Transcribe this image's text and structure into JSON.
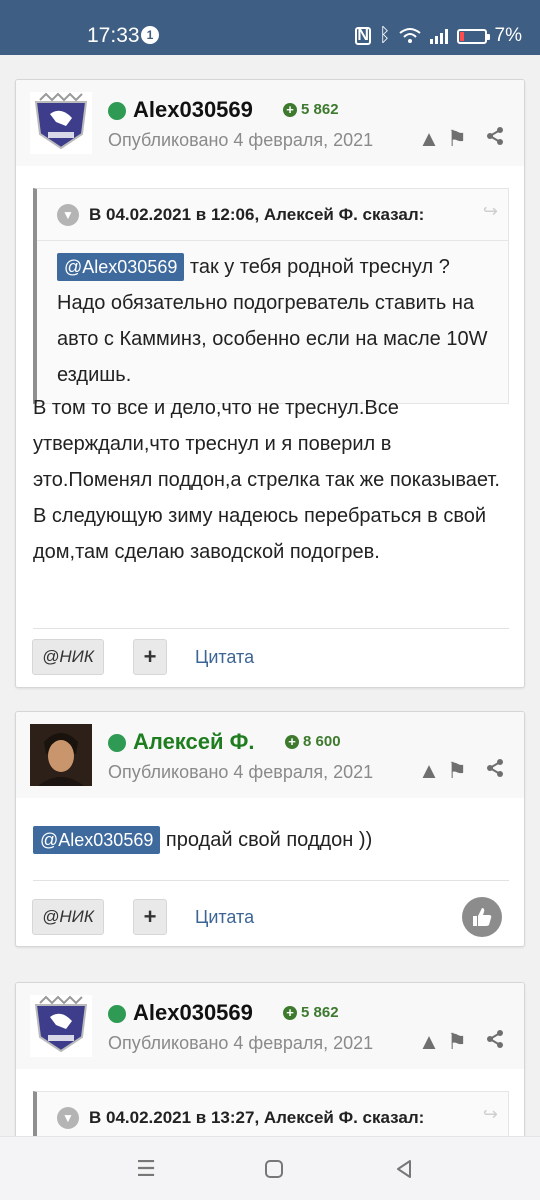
{
  "status_bar": {
    "time": "17:33",
    "notification_count": "1",
    "battery": "7%"
  },
  "posts": [
    {
      "author": "Alex030569",
      "reputation": "5 862",
      "meta": "Опубликовано 4 февраля, 2021",
      "quote": {
        "title": "В 04.02.2021 в 12:06, Алексей Ф. сказал:",
        "mention": "@Alex030569",
        "text": "так у тебя родной треснул ? Надо обязательно подогреватель ставить на авто с Камминз, особенно если на масле 10W ездишь."
      },
      "body_lines": [
        "В том то все и дело,что не треснул.Все утверждали,что треснул и я поверил в это.Поменял поддон,а стрелка так же показывает.",
        "В следующую зиму надеюсь перебраться в свой дом,там сделаю заводской подогрев."
      ],
      "actions": {
        "nick": "@НИК",
        "plus": "+",
        "quote": "Цитата"
      }
    },
    {
      "author": "Алексей Ф.",
      "reputation": "8 600",
      "meta": "Опубликовано 4 февраля, 2021",
      "mention": "@Alex030569",
      "body": "продай свой поддон  ))",
      "actions": {
        "nick": "@НИК",
        "plus": "+",
        "quote": "Цитата"
      }
    },
    {
      "author": "Alex030569",
      "reputation": "5 862",
      "meta": "Опубликовано 4 февраля, 2021",
      "quote": {
        "title": "В 04.02.2021 в 13:27, Алексей Ф. сказал:"
      }
    }
  ],
  "colors": {
    "status_bar": "#3e5e84",
    "mention_bg": "#3e6a9e",
    "online": "#2e9a53",
    "reputation": "#3d7a2e",
    "link": "#3c6596"
  },
  "icons": [
    "report-icon",
    "flag-icon",
    "share-icon",
    "chevron-down-icon",
    "like-icon",
    "menu-icon",
    "home-icon",
    "back-icon"
  ]
}
